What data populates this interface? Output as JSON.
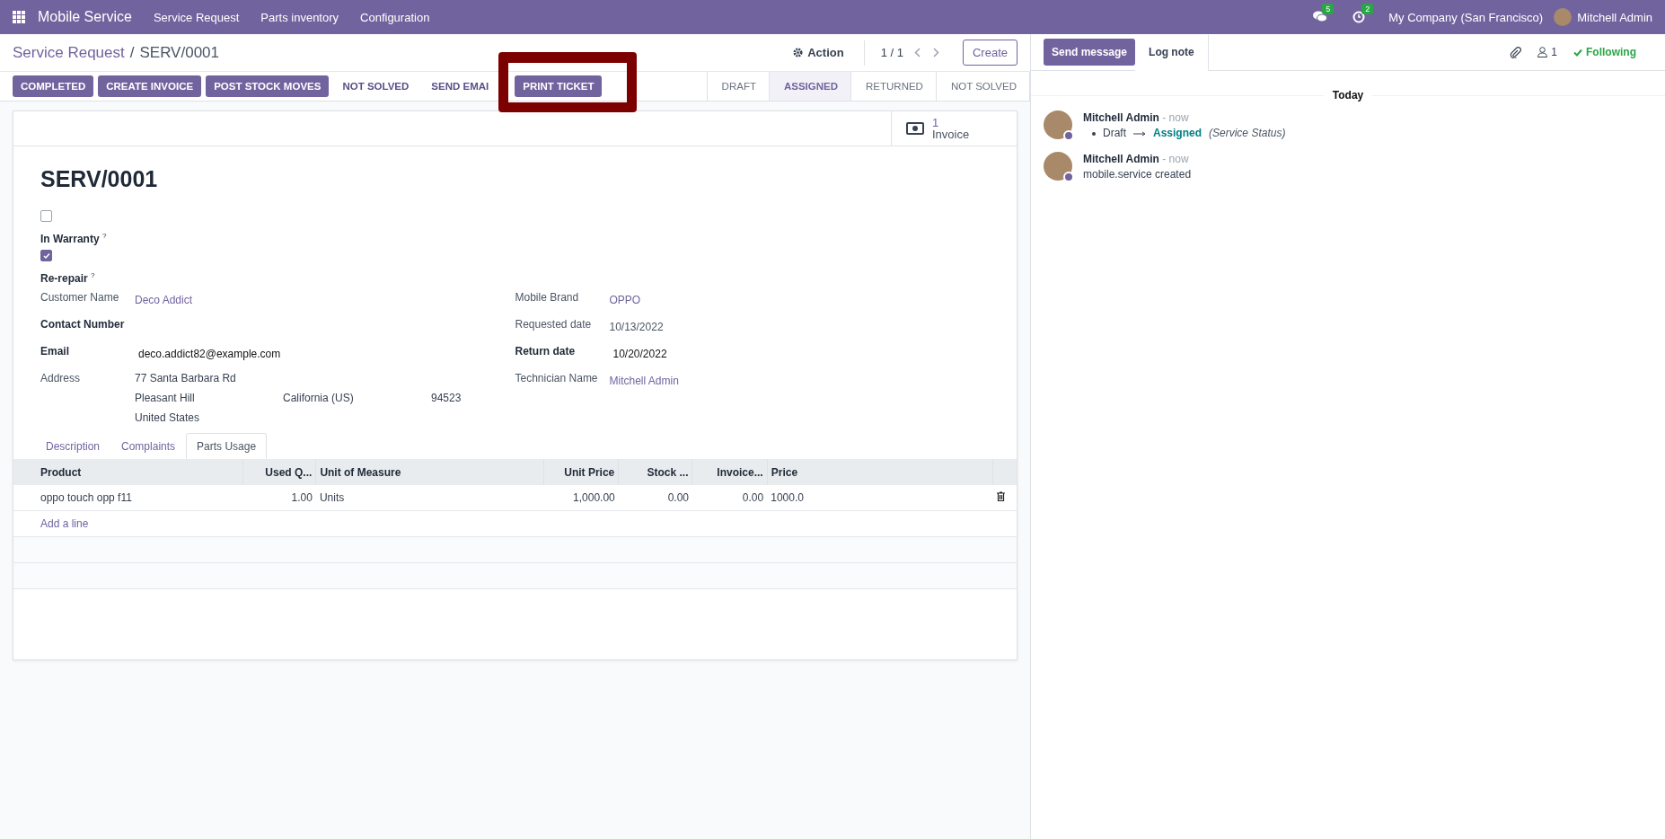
{
  "navbar": {
    "app_name": "Mobile Service",
    "menu": [
      "Service Request",
      "Parts inventory",
      "Configuration"
    ],
    "messages_badge": "5",
    "activities_badge": "2",
    "company": "My Company (San Francisco)",
    "user": "Mitchell Admin"
  },
  "control_panel": {
    "breadcrumb": [
      "Service Request",
      "SERV/0001"
    ],
    "breadcrumb_separator": "/",
    "action": "Action",
    "pager": "1 / 1",
    "create": "Create",
    "buttons": [
      {
        "label": "COMPLETED",
        "kind": "primary",
        "highlighted": false
      },
      {
        "label": "CREATE INVOICE",
        "kind": "primary",
        "highlighted": false
      },
      {
        "label": "POST STOCK MOVES",
        "kind": "primary",
        "highlighted": false
      },
      {
        "label": "NOT SOLVED",
        "kind": "secondary",
        "highlighted": false
      },
      {
        "label": "SEND EMAI",
        "kind": "secondary",
        "highlighted": false
      },
      {
        "label": "PRINT TICKET",
        "kind": "primary",
        "highlighted": true
      }
    ],
    "status_steps": [
      {
        "label": "DRAFT",
        "selected": false
      },
      {
        "label": "ASSIGNED",
        "selected": true
      },
      {
        "label": "RETURNED",
        "selected": false
      },
      {
        "label": "NOT SOLVED",
        "selected": false
      }
    ]
  },
  "form": {
    "smart_button": {
      "count": "1",
      "label": "Invoice"
    },
    "title": "SERV/0001",
    "checkboxes": [
      {
        "label": "In Warranty",
        "help": "?",
        "checked": false
      },
      {
        "label": "Re-repair",
        "help": "?",
        "checked": true
      }
    ],
    "left_fields": [
      {
        "label": "Customer Name",
        "required": false,
        "kind": "link",
        "value": "Deco Addict"
      },
      {
        "label": "Contact Number",
        "required": true,
        "kind": "empty"
      },
      {
        "label": "Email",
        "required": true,
        "kind": "text",
        "value": "deco.addict82@example.com"
      },
      {
        "label": "Address",
        "required": false,
        "kind": "address",
        "street": "77 Santa Barbara Rd",
        "city": "Pleasant Hill",
        "state": "California (US)",
        "zip": "94523",
        "country": "United States"
      }
    ],
    "right_fields": [
      {
        "label": "Mobile Brand",
        "required": false,
        "kind": "link",
        "value": "OPPO"
      },
      {
        "label": "Requested date",
        "required": false,
        "kind": "muted",
        "value": "10/13/2022"
      },
      {
        "label": "Return date",
        "required": true,
        "kind": "text",
        "value": "10/20/2022"
      },
      {
        "label": "Technician Name",
        "required": false,
        "kind": "link",
        "value": "Mitchell Admin"
      }
    ],
    "tabs": [
      {
        "label": "Description",
        "selected": false
      },
      {
        "label": "Complaints",
        "selected": false
      },
      {
        "label": "Parts Usage",
        "selected": true
      }
    ],
    "table": {
      "columns": [
        "Product",
        "Used Q...",
        "Unit of Measure",
        "Unit Price",
        "Stock ...",
        "Invoice...",
        "Price"
      ],
      "rows": [
        {
          "cells": [
            "oppo touch opp f11",
            "1.00",
            "Units",
            "1,000.00",
            "0.00",
            "0.00",
            "1000.0"
          ]
        }
      ],
      "add_line": "Add a line"
    }
  },
  "chatter": {
    "send_message": "Send message",
    "log_note": "Log note",
    "followers_count": "1",
    "following": "Following",
    "date_separator": "Today",
    "messages": [
      {
        "author": "Mitchell Admin",
        "time": "- now",
        "kind": "tracking",
        "old_value": "Draft",
        "new_value": "Assigned",
        "field": "(Service Status)"
      },
      {
        "author": "Mitchell Admin",
        "time": "- now",
        "kind": "text",
        "body": "mobile.service created"
      }
    ]
  }
}
